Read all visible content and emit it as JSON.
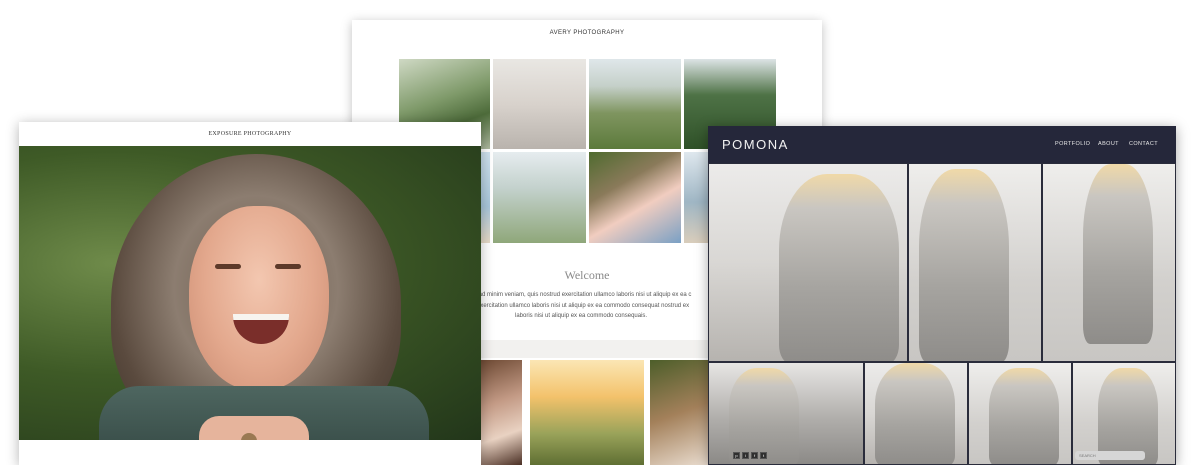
{
  "avery": {
    "title": "AVERY PHOTOGRAPHY",
    "welcome_heading": "Welcome",
    "body_line1": "m ad minim veniam, quis nostrud exercitation ullamco laboris nisi ut aliquip ex ea c",
    "body_line2": "d exercitation ullamco laboris nisi ut aliquip ex ea commodo consequat nostrud ex",
    "body_line3": "laboris nisi ut aliquip ex ea commodo consequais."
  },
  "exposure": {
    "title": "EXPOSURE PHOTOGRAPHY",
    "scroll_icon": "chevron-down-icon"
  },
  "pomona": {
    "logo": "POMONA",
    "nav": [
      "PORTFOLIO",
      "ABOUT",
      "CONTACT"
    ],
    "search_placeholder": "SEARCH",
    "social_icons": [
      "pinterest-icon",
      "instagram-icon",
      "facebook-icon",
      "twitter-icon"
    ]
  }
}
